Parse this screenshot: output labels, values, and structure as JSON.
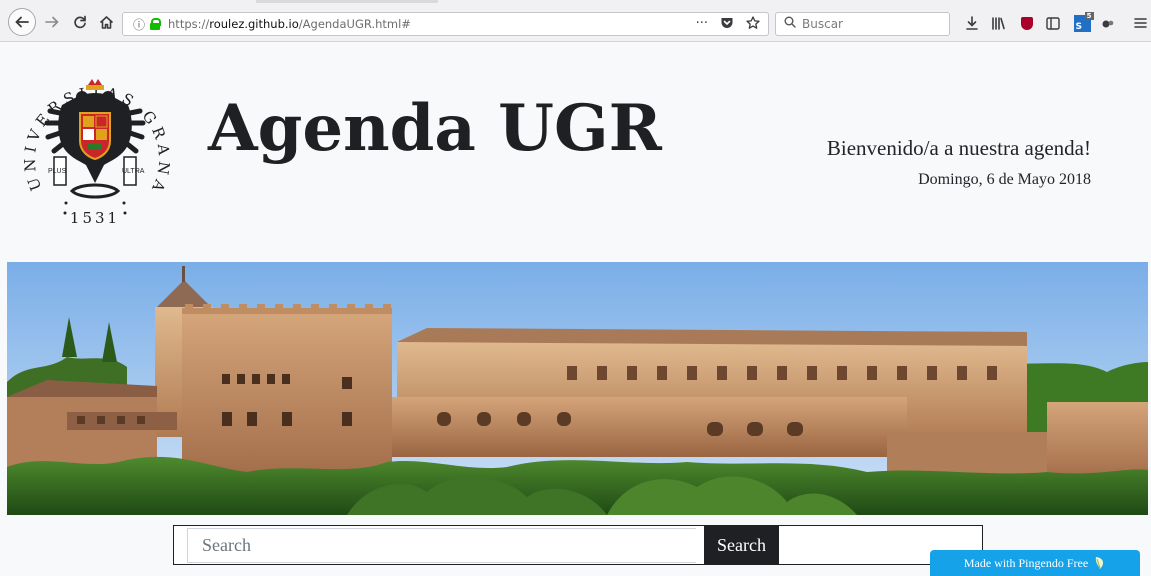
{
  "browser": {
    "url_scheme": "https://",
    "url_host": "roulez.github.io",
    "url_path": "/AgendaUGR.html#",
    "search_placeholder": "Buscar",
    "more_glyph": "···"
  },
  "logo": {
    "ring_text": "UNIVERSITAS GRANATENSIS",
    "year": "1531",
    "motto_left": "PLUS",
    "motto_right": "ULTRA"
  },
  "header": {
    "title": "Agenda UGR",
    "welcome": "Bienvenido/a a nuestra agenda!",
    "date": "Domingo, 6 de Mayo 2018"
  },
  "search": {
    "placeholder": "Search",
    "button_label": "Search"
  },
  "badge": {
    "label": "Made with Pingendo Free"
  },
  "colors": {
    "accent_dark": "#1f2024",
    "badge_blue": "#16a2e8",
    "lock_green": "#12bc00"
  }
}
